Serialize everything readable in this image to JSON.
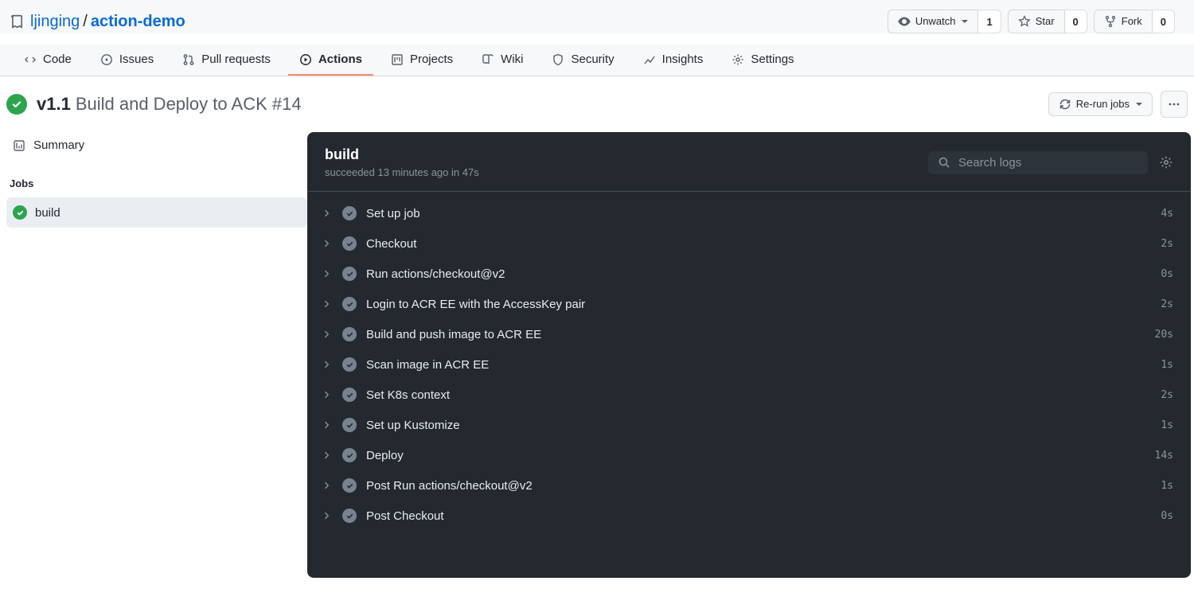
{
  "repo": {
    "owner": "ljinging",
    "name": "action-demo"
  },
  "repoActions": {
    "unwatch": {
      "label": "Unwatch",
      "count": "1"
    },
    "star": {
      "label": "Star",
      "count": "0"
    },
    "fork": {
      "label": "Fork",
      "count": "0"
    }
  },
  "tabs": {
    "code": "Code",
    "issues": "Issues",
    "pulls": "Pull requests",
    "actions": "Actions",
    "projects": "Projects",
    "wiki": "Wiki",
    "security": "Security",
    "insights": "Insights",
    "settings": "Settings"
  },
  "workflow": {
    "name": "v1.1",
    "suffix": "Build and Deploy to ACK #14",
    "rerun_label": "Re-run jobs"
  },
  "sidebar": {
    "summary": "Summary",
    "jobs_heading": "Jobs",
    "job0": "build"
  },
  "jobPanel": {
    "title": "build",
    "subtitle": "succeeded 13 minutes ago in 47s",
    "search_placeholder": "Search logs"
  },
  "steps": [
    {
      "name": "Set up job",
      "time": "4s"
    },
    {
      "name": "Checkout",
      "time": "2s"
    },
    {
      "name": "Run actions/checkout@v2",
      "time": "0s"
    },
    {
      "name": "Login to ACR EE with the AccessKey pair",
      "time": "2s"
    },
    {
      "name": "Build and push image to ACR EE",
      "time": "20s"
    },
    {
      "name": "Scan image in ACR EE",
      "time": "1s"
    },
    {
      "name": "Set K8s context",
      "time": "2s"
    },
    {
      "name": "Set up Kustomize",
      "time": "1s"
    },
    {
      "name": "Deploy",
      "time": "14s"
    },
    {
      "name": "Post Run actions/checkout@v2",
      "time": "1s"
    },
    {
      "name": "Post Checkout",
      "time": "0s"
    }
  ]
}
